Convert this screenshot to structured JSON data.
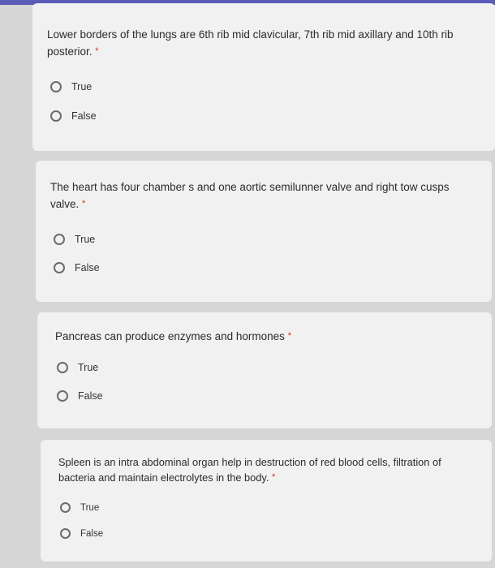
{
  "colors": {
    "accent": "#5b5bb8",
    "required": "#d93025",
    "card_background": "#f1f1f1",
    "page_background": "#d6d6d6"
  },
  "required_marker": "*",
  "questions": [
    {
      "text": "Lower borders of the lungs are 6th rib mid clavicular, 7th rib mid axillary and 10th rib posterior.",
      "options": [
        "True",
        "False"
      ]
    },
    {
      "text": "The heart has four chamber s and one aortic semilunner valve and right tow cusps valve.",
      "options": [
        "True",
        "False"
      ]
    },
    {
      "text": "Pancreas can produce enzymes and hormones",
      "options": [
        "True",
        "False"
      ]
    },
    {
      "text": "Spleen is an intra abdominal organ help in destruction of red blood cells, filtration of bacteria and maintain electrolytes in the body.",
      "options": [
        "True",
        "False"
      ]
    }
  ]
}
